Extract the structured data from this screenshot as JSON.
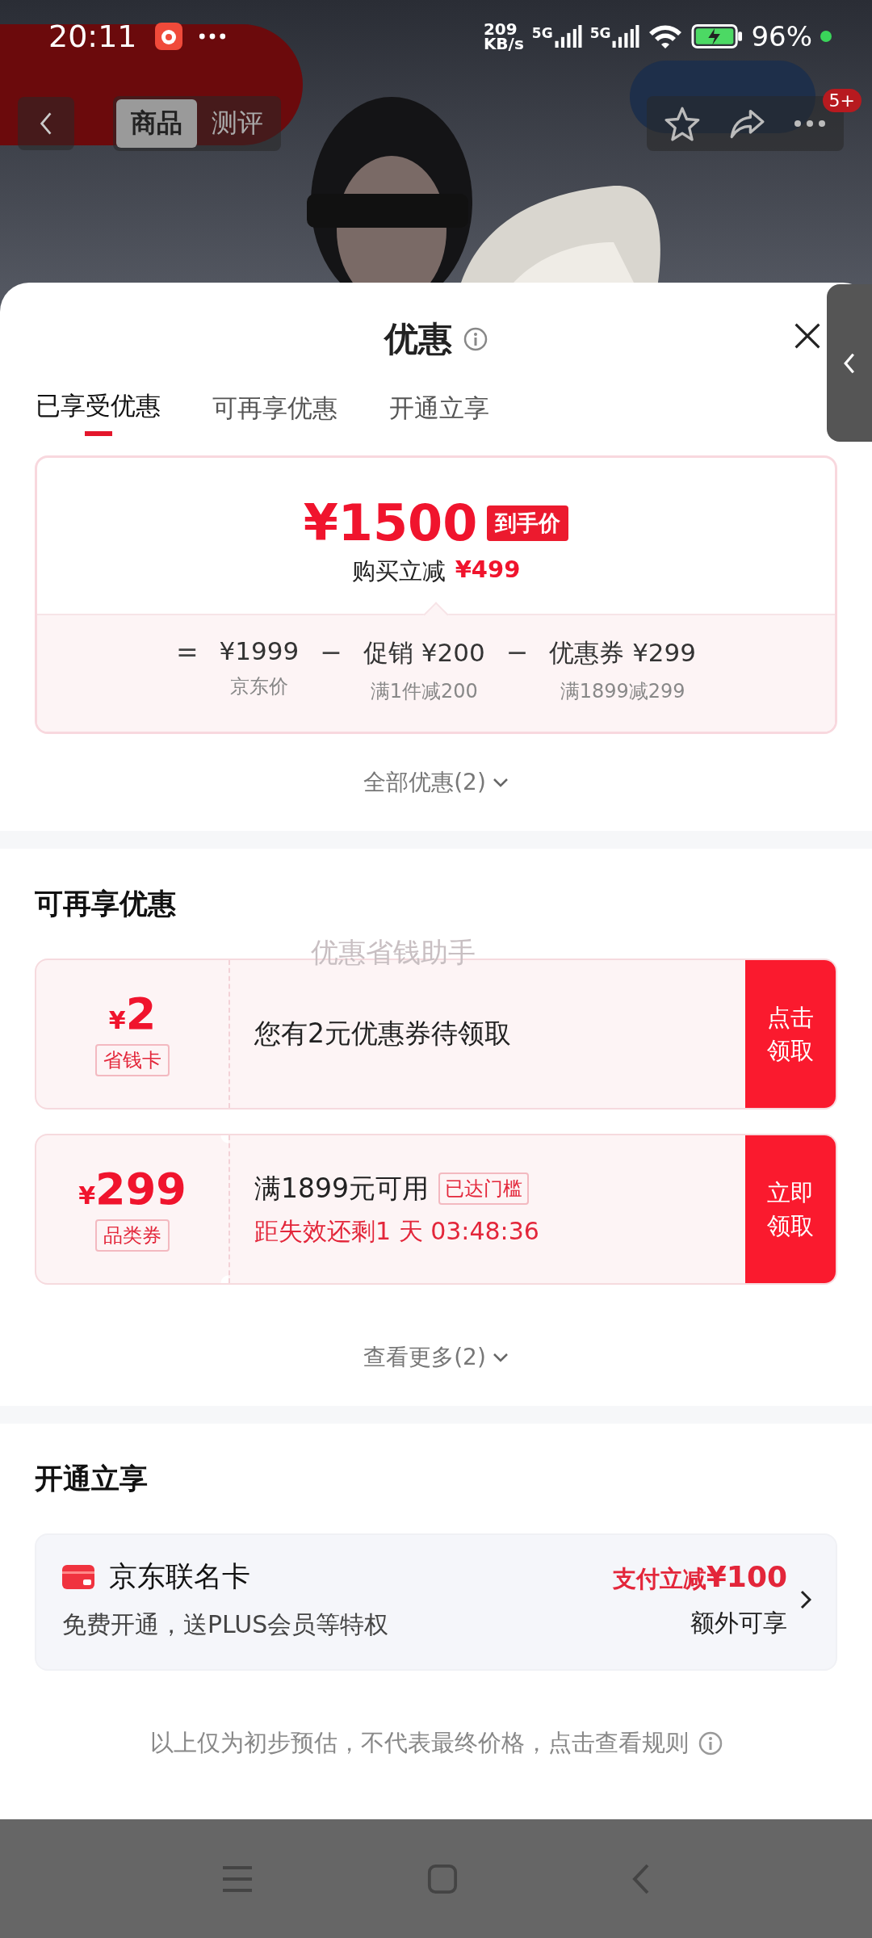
{
  "status_bar": {
    "time": "20:11",
    "speed_value": "209",
    "speed_unit": "KB/s",
    "sim_1": "5G",
    "sim_2": "5G",
    "battery": "96%"
  },
  "header": {
    "tabs": [
      {
        "label": "商品",
        "selected": true
      },
      {
        "label": "测评",
        "selected": false
      }
    ],
    "badge": "5+"
  },
  "sheet": {
    "title": "优惠",
    "tabs": [
      {
        "label": "已享受优惠",
        "selected": true
      },
      {
        "label": "可再享优惠",
        "selected": false
      },
      {
        "label": "开通立享",
        "selected": false
      }
    ],
    "summary": {
      "price": "¥1500",
      "price_tag": "到手价",
      "saving_label": "购买立减",
      "saving_amount": "¥499",
      "breakdown": [
        {
          "operator": "=",
          "value": "¥1999",
          "note": "京东价"
        },
        {
          "operator": "−",
          "value": "促销 ¥200",
          "note": "满1件减200"
        },
        {
          "operator": "−",
          "value": "优惠券 ¥299",
          "note": "满1899减299"
        }
      ]
    },
    "expand_link": "全部优惠(2)",
    "more_offers": {
      "title": "可再享优惠",
      "floating_label": "优惠省钱助手",
      "coupons": [
        {
          "kind": "card",
          "currency": "¥",
          "amount": "2",
          "tag": "省钱卡",
          "text": "您有2元优惠券待领取",
          "button": "点击领取"
        },
        {
          "kind": "coupon",
          "currency": "¥",
          "amount": "299",
          "tag": "品类券",
          "text": "满1899元可用",
          "badge": "已达门槛",
          "countdown": "距失效还剩1 天 03:48:36",
          "button": "立即领取"
        }
      ],
      "more_link": "查看更多(2)"
    },
    "membership": {
      "title": "开通立享",
      "card": {
        "name": "京东联名卡",
        "description": "免费开通，送PLUS会员等特权",
        "offer": "支付立减**¥100**",
        "extra": "额外可享"
      }
    },
    "disclaimer": "以上仅为初步预估，不代表最终价格，点击查看规则"
  }
}
